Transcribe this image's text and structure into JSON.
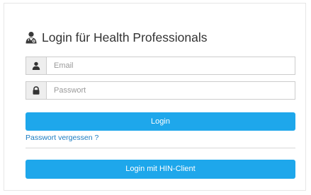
{
  "login": {
    "title": "Login für Health Professionals",
    "title_icon": "doctor-icon",
    "email": {
      "icon": "user-icon",
      "placeholder": "Email",
      "value": ""
    },
    "password": {
      "icon": "lock-icon",
      "placeholder": "Passwort",
      "value": ""
    },
    "login_button_label": "Login",
    "forgot_password_link": "Passwort vergessen ?",
    "hin_button_label": "Login mit HIN-Client"
  },
  "colors": {
    "primary_button": "#1ea7eb",
    "link": "#1b7bc0",
    "title_text": "#333333",
    "addon_background": "#eeeeee",
    "border": "#cccccc"
  }
}
